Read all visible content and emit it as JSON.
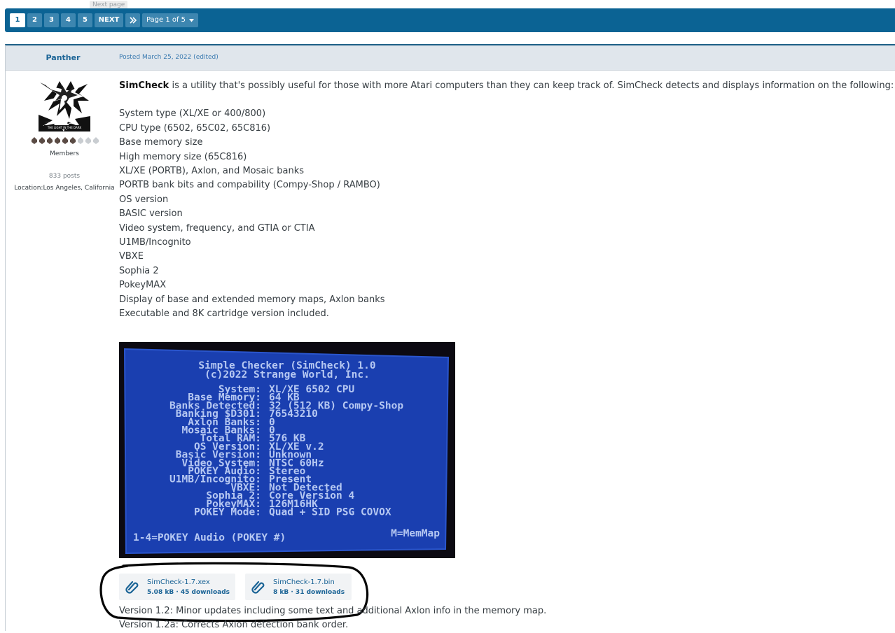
{
  "tooltip": "Next page",
  "pagination": {
    "pages": [
      "1",
      "2",
      "3",
      "4",
      "5"
    ],
    "active": "1",
    "next_label": "NEXT",
    "last_label": "»",
    "page_of": "Page 1 of 5"
  },
  "post": {
    "author": "Panther",
    "posted": "Posted March 25, 2022 (edited)",
    "group": "Members",
    "posts_count": "833 posts",
    "location_label": "Location:",
    "location_value": "Los Angeles, California",
    "intro_bold": "SimCheck",
    "intro_rest": " is a utility that's possibly useful for those with more Atari computers than they can keep track of.  SimCheck detects and displays information on the following:",
    "features": [
      "System type (XL/XE or 400/800)",
      "CPU type (6502, 65C02, 65C816)",
      "Base memory size",
      "High memory size (65C816)",
      "XL/XE (PORTB), Axlon, and Mosaic banks",
      "PORTB bank bits and compability (Compy-Shop / RAMBO)",
      "OS version",
      "BASIC version",
      "Video system, frequency, and GTIA or CTIA",
      "U1MB/Incognito",
      "VBXE",
      "Sophia 2",
      "PokeyMAX",
      "Display of base and extended memory maps, Axlon banks",
      "Executable and 8K cartridge version included."
    ],
    "attachments": [
      {
        "name": "SimCheck-1.7.xex",
        "meta": "5.08 kB · 45 downloads"
      },
      {
        "name": "SimCheck-1.7.bin",
        "meta": "8 kB · 31 downloads"
      }
    ],
    "version_notes": [
      "Version 1.2: Minor updates including some text and additional Axlon info in the memory map.",
      "Version 1.2a: Corrects Axlon detection bank order."
    ]
  },
  "screen": {
    "title1": "Simple Checker (SimCheck) 1.0",
    "title2": "(c)2022 Strange World, Inc.",
    "rows": [
      {
        "label": "System:",
        "value": "XL/XE 6502 CPU"
      },
      {
        "label": "Base Memory:",
        "value": "64 KB"
      },
      {
        "label": "Banks Detected:",
        "value": "32 (512 KB) Compy-Shop"
      },
      {
        "label": "Banking $D301:",
        "value": "76543210"
      },
      {
        "label": "Axlon Banks:",
        "value": "0"
      },
      {
        "label": "Mosaic Banks:",
        "value": "0"
      },
      {
        "label": "Total RAM:",
        "value": "576 KB"
      },
      {
        "label": "OS Version:",
        "value": "XL/XE v.2"
      },
      {
        "label": "Basic Version:",
        "value": "Unknown"
      },
      {
        "label": "Video System:",
        "value": "NTSC 60Hz"
      },
      {
        "label": "POKEY Audio:",
        "value": "Stereo"
      },
      {
        "label": "U1MB/Incognito:",
        "value": "Present"
      },
      {
        "label": "VBXE:",
        "value": "Not Detected"
      },
      {
        "label": "Sophia 2:",
        "value": "Core Version 4"
      },
      {
        "label": "PokeyMAX:",
        "value": "126M16HK"
      },
      {
        "label": "POKEY Mode:",
        "value": "Quad + SID PSG COVOX"
      }
    ],
    "footer_left": "1-4=POKEY Audio (POKEY #)",
    "footer_right": "M=MemMap"
  },
  "colors": {
    "brand": "#0b6394",
    "header_bg": "#e0e6ec",
    "link": "#1b6496",
    "screen_blue": "#1a3fb0",
    "screen_text": "#b6c8f2"
  }
}
